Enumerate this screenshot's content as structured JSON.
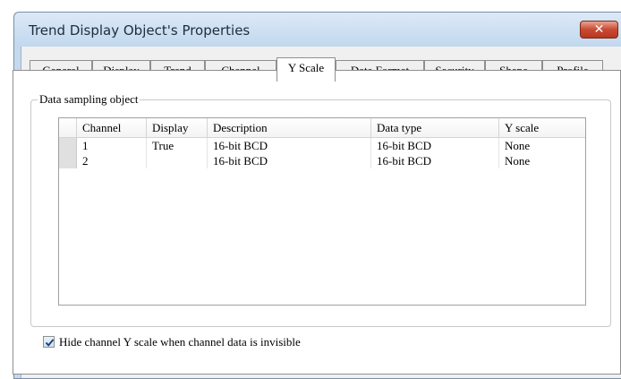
{
  "window": {
    "title": "Trend Display Object's Properties",
    "close_glyph": "✕"
  },
  "tabs": [
    {
      "label": "General"
    },
    {
      "label": "Display"
    },
    {
      "label": "Trend"
    },
    {
      "label": "Channel"
    },
    {
      "label": "Y Scale",
      "active": true
    },
    {
      "label": "Data Format"
    },
    {
      "label": "Security"
    },
    {
      "label": "Shape"
    },
    {
      "label": "Profile"
    }
  ],
  "group": {
    "label": "Data sampling object"
  },
  "grid": {
    "headers": [
      "Channel",
      "Display",
      "Description",
      "Data type",
      "Y scale"
    ],
    "rows": [
      [
        "1",
        "True",
        "16-bit BCD",
        "16-bit BCD",
        "None"
      ],
      [
        "2",
        "",
        "16-bit BCD",
        "16-bit BCD",
        "None"
      ]
    ]
  },
  "options": {
    "hide_channel_y_scale": {
      "label": "Hide channel Y scale when channel data is invisible",
      "checked": true
    }
  }
}
